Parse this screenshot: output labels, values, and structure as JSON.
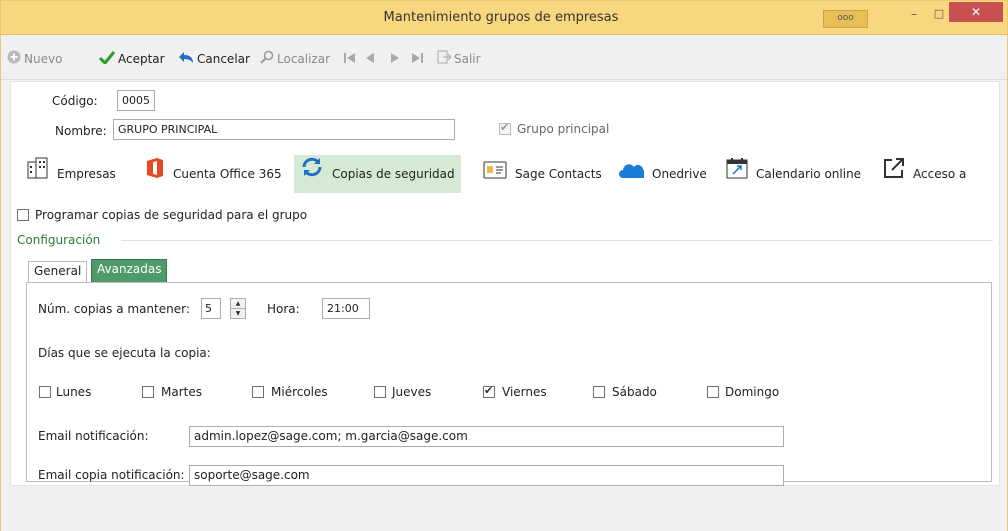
{
  "window": {
    "title": "Mantenimiento grupos de empresas",
    "dots": "ooo",
    "minimize": "–",
    "maximize": "□",
    "close": "✕"
  },
  "toolbar": {
    "nuevo": "Nuevo",
    "aceptar": "Aceptar",
    "cancelar": "Cancelar",
    "localizar": "Localizar",
    "salir": "Salir"
  },
  "form": {
    "codigo_label": "Código:",
    "codigo_value": "0005",
    "nombre_label": "Nombre:",
    "nombre_value": "GRUPO PRINCIPAL",
    "grupo_principal_label": "Grupo principal",
    "grupo_principal_checked": true
  },
  "nav": [
    {
      "label": "Empresas",
      "icon": "building-icon"
    },
    {
      "label": "Cuenta Office 365",
      "icon": "office-icon"
    },
    {
      "label": "Copias de seguridad",
      "icon": "sync-icon",
      "selected": true
    },
    {
      "label": "Sage Contacts",
      "icon": "contact-card-icon"
    },
    {
      "label": "Onedrive",
      "icon": "cloud-icon"
    },
    {
      "label": "Calendario online",
      "icon": "calendar-icon"
    },
    {
      "label": "Acceso a",
      "icon": "external-link-icon"
    }
  ],
  "backup": {
    "programar_label": "Programar copias de seguridad para el grupo",
    "programar_checked": false,
    "configuracion_label": "Configuración",
    "tabs": [
      "General",
      "Avanzadas"
    ],
    "active_tab": "Avanzadas",
    "num_copias_label": "Núm. copias a mantener:",
    "num_copias_value": "5",
    "hora_label": "Hora:",
    "hora_value": "21:00",
    "dias_label": "Días que se ejecuta la copia:",
    "days": [
      {
        "label": "Lunes",
        "checked": false
      },
      {
        "label": "Martes",
        "checked": false
      },
      {
        "label": "Miércoles",
        "checked": false
      },
      {
        "label": "Jueves",
        "checked": false
      },
      {
        "label": "Viernes",
        "checked": true
      },
      {
        "label": "Sábado",
        "checked": false
      },
      {
        "label": "Domingo",
        "checked": false
      }
    ],
    "email_label": "Email notificación:",
    "email_value": "admin.lopez@sage.com; m.garcia@sage.com",
    "email_copia_label": "Email copia notificación:",
    "email_copia_value": "soporte@sage.com"
  },
  "colors": {
    "titlebar": "#f8d77e",
    "accent_green": "#4e9a6b",
    "selected_nav": "#d5ead5",
    "close_button": "#c75050"
  }
}
